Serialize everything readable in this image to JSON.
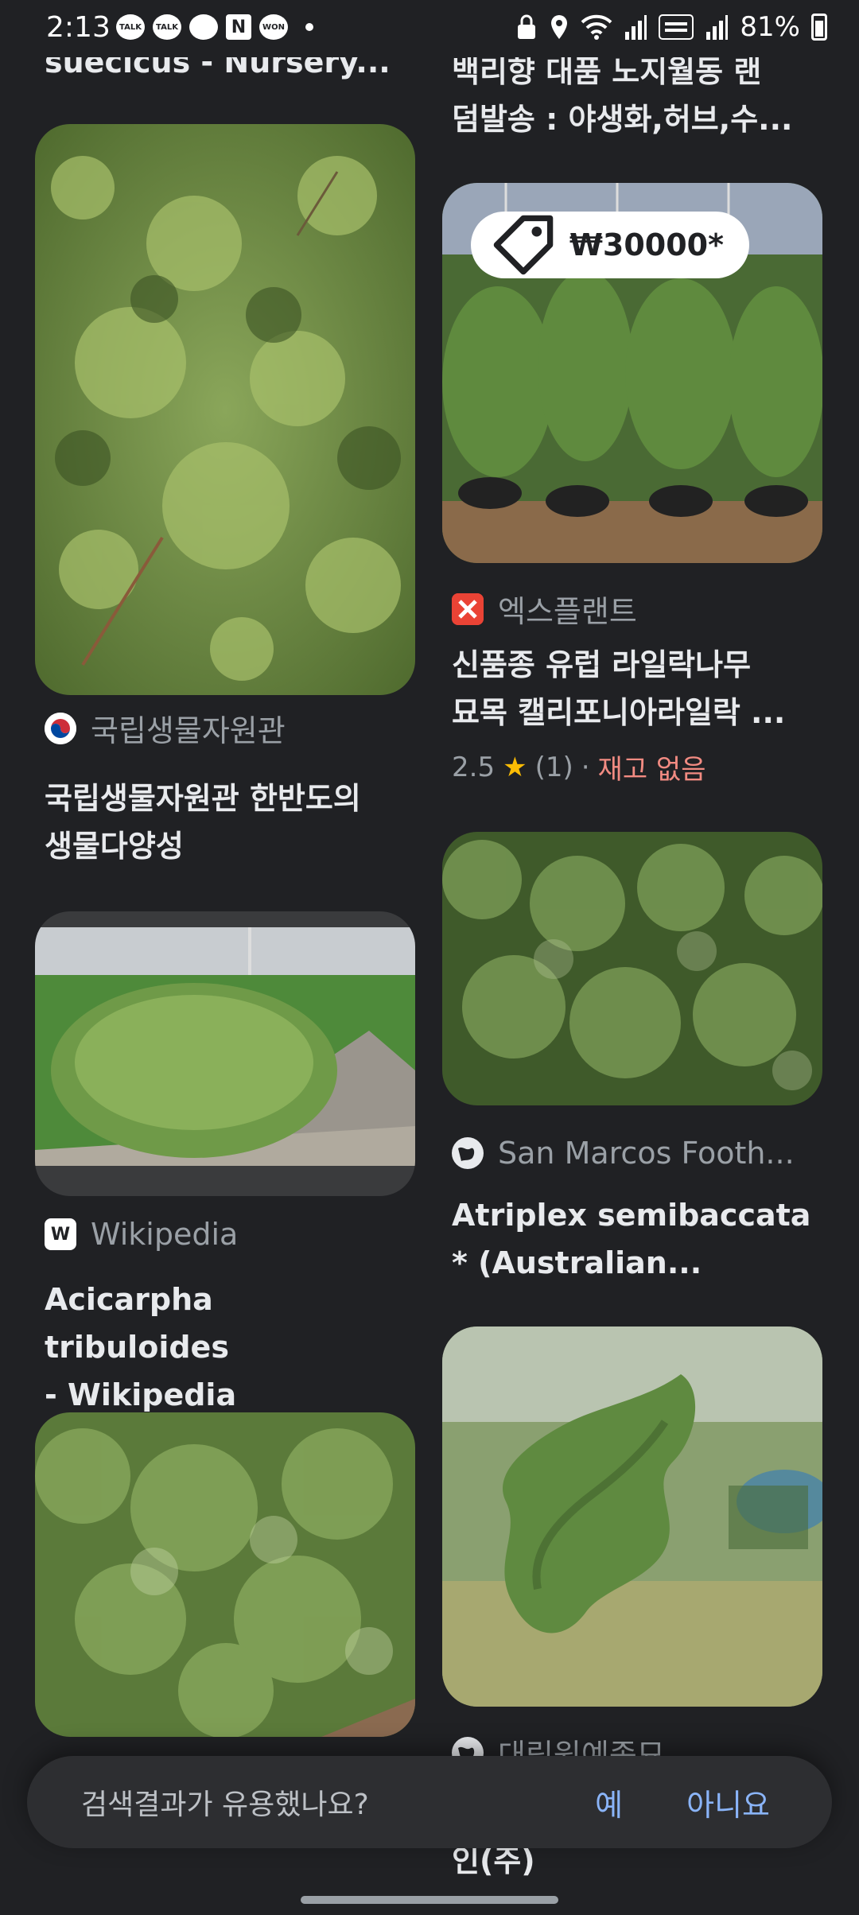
{
  "status": {
    "time": "2:13",
    "battery": "81%",
    "notif_icons": [
      "TALK",
      "TALK",
      "chat-icon",
      "N",
      "WON"
    ]
  },
  "results": {
    "left": [
      {
        "title": "suecicus - Nursery..."
      },
      {
        "source": "국립생물자원관",
        "title_line1": "국립생물자원관 한반도의",
        "title_line2": "생물다양성"
      },
      {
        "source": "Wikipedia",
        "title_line1": "Acicarpha tribuloides",
        "title_line2": "- Wikipedia"
      },
      {}
    ],
    "right": [
      {
        "title_line1": "백리향 대품 노지월동 랜",
        "title_line2": "덤발송 : 야생화,허브,수..."
      },
      {
        "price": "₩30000*",
        "source": "엑스플랜트",
        "title_line1": "신품종 유럽 라일락나무",
        "title_line2": "묘목 캘리포니아라일락 ...",
        "rating": "2.5",
        "rating_count": "(1)",
        "separator": "·",
        "stock": "재고 없음"
      },
      {
        "source": "San Marcos Footh...",
        "title_line1": "Atriplex semibaccata",
        "title_line2": "* (Australian..."
      },
      {
        "source": "대림원예종묘",
        "title_fragment": "인(주)"
      }
    ]
  },
  "feedback": {
    "question": "검색결과가 유용했나요?",
    "yes": "예",
    "no": "아니요"
  },
  "colors": {
    "background": "#202124",
    "link": "#8ab4f8",
    "out_of_stock": "#f28b82",
    "star": "#fbbc04"
  }
}
